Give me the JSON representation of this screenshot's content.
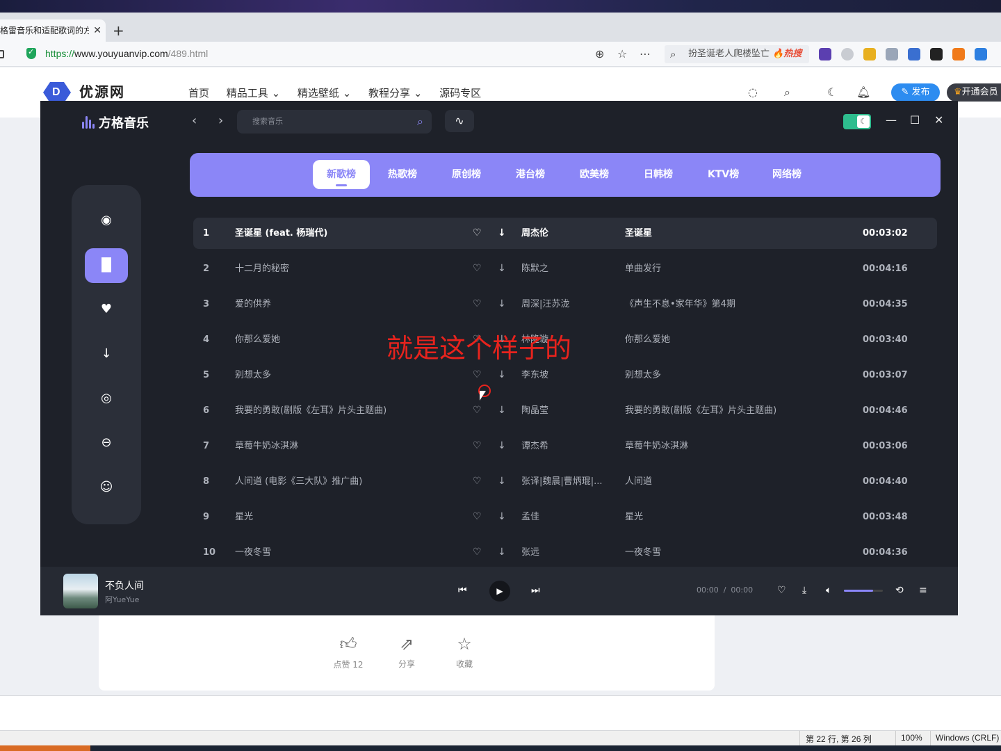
{
  "browser": {
    "tab_title": "格雷音乐和适配歌词的方",
    "url_scheme": "https://",
    "url_host": "www.youyuanvip.com",
    "url_path": "/489.html",
    "search_text": "扮圣诞老人爬楼坠亡",
    "search_hot": "🔥热搜"
  },
  "site": {
    "name": "优源网",
    "nav": [
      "首页",
      "精品工具 ⌄",
      "精选壁纸 ⌄",
      "教程分享 ⌄",
      "源码专区"
    ],
    "publish": "发布",
    "vip": "开通会员"
  },
  "app": {
    "name": "方格音乐",
    "search_placeholder": "搜索音乐",
    "categories": [
      "新歌榜",
      "热歌榜",
      "原创榜",
      "港台榜",
      "欧美榜",
      "日韩榜",
      "KTV榜",
      "网络榜"
    ],
    "active_category": "新歌榜",
    "songs": [
      {
        "no": "1",
        "title": "圣诞星 (feat. 杨瑞代)",
        "artist": "周杰伦",
        "album": "圣诞星",
        "duration": "00:03:02"
      },
      {
        "no": "2",
        "title": "十二月的秘密",
        "artist": "陈默之",
        "album": "单曲发行",
        "duration": "00:04:16"
      },
      {
        "no": "3",
        "title": "爱的供养",
        "artist": "周深|汪苏泷",
        "album": "《声生不息•家年华》第4期",
        "duration": "00:04:35"
      },
      {
        "no": "4",
        "title": "你那么爱她",
        "artist": "林隆璇",
        "album": "你那么爱她",
        "duration": "00:03:40"
      },
      {
        "no": "5",
        "title": "别想太多",
        "artist": "李东坡",
        "album": "别想太多",
        "duration": "00:03:07"
      },
      {
        "no": "6",
        "title": "我要的勇敢(剧版《左耳》片头主题曲)",
        "artist": "陶晶莹",
        "album": "我要的勇敢(剧版《左耳》片头主题曲)",
        "duration": "00:04:46"
      },
      {
        "no": "7",
        "title": "草莓牛奶冰淇淋",
        "artist": "谭杰希",
        "album": "草莓牛奶冰淇淋",
        "duration": "00:03:06"
      },
      {
        "no": "8",
        "title": "人间道 (电影《三大队》推广曲)",
        "artist": "张译|魏晨|曹炳琨|...",
        "album": "人间道",
        "duration": "00:04:40"
      },
      {
        "no": "9",
        "title": "星光",
        "artist": "孟佳",
        "album": "星光",
        "duration": "00:03:48"
      },
      {
        "no": "10",
        "title": "一夜冬雪",
        "artist": "张远",
        "album": "一夜冬雪",
        "duration": "00:04:36"
      }
    ],
    "overlay_caption": "就是这个样子的",
    "player": {
      "song": "不负人间",
      "artist": "阿YueYue",
      "current_time": "00:00",
      "total_time": "00:00",
      "time_sep": "/",
      "volume": 0.75
    }
  },
  "article_actions": [
    {
      "icon": "thumbs-up-icon",
      "label": "点赞 12"
    },
    {
      "icon": "share-icon",
      "label": "分享"
    },
    {
      "icon": "star-icon",
      "label": "收藏"
    }
  ],
  "statusbar": {
    "position": "第 22 行, 第 26 列",
    "zoom": "100%",
    "line_ending": "Windows (CRLF)"
  },
  "colors": {
    "accent": "#8b86f7",
    "app_bg": "#1e2129",
    "caption": "#e8231d"
  }
}
